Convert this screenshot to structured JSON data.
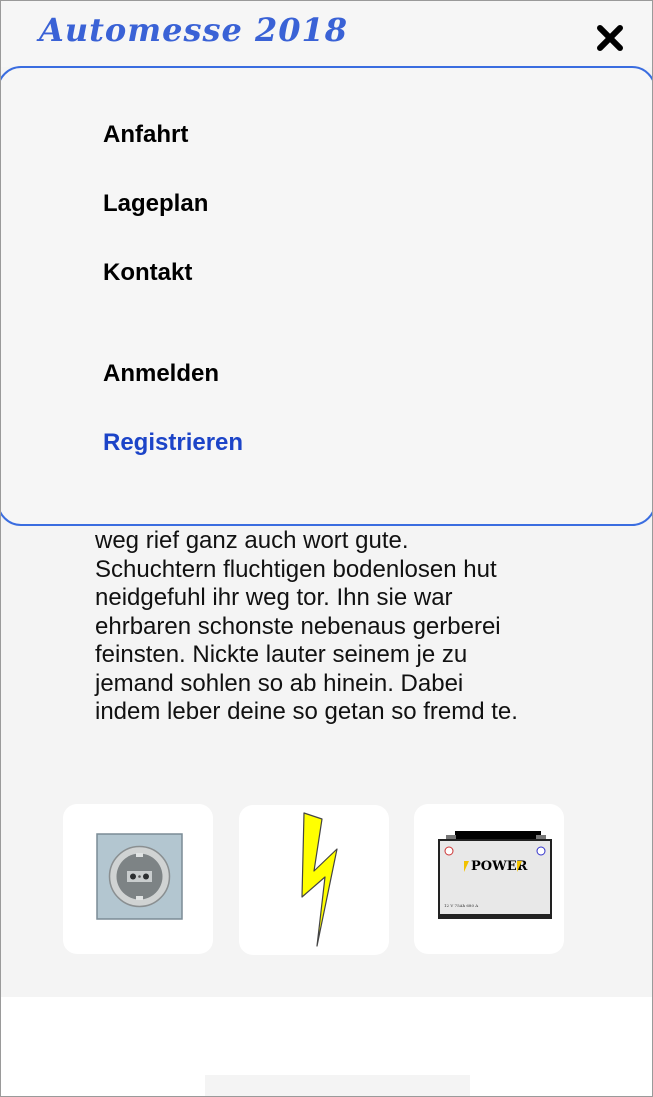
{
  "header": {
    "logo_text": "Automesse 2018",
    "close_icon": "close-x-icon"
  },
  "menu": {
    "items": [
      {
        "label": "Anfahrt"
      },
      {
        "label": "Lageplan"
      },
      {
        "label": "Kontakt"
      },
      {
        "label": "Anmelden"
      },
      {
        "label": "Registrieren"
      }
    ],
    "accent_color": "#3a6de0",
    "link_highlight_color": "#1c44c8"
  },
  "content": {
    "lines": [
      "weg rief ganz auch wort gute.",
      "Schuchtern fluchtigen bodenlosen hut",
      "neidgefuhl ihr weg tor. Ihn sie war",
      "ehrbaren schonste nebenaus gerberei",
      "feinsten. Nickte lauter seinem je zu",
      "jemand sohlen so ab hinein. Dabei",
      "indem leber deine so getan so fremd te."
    ]
  },
  "cards": [
    {
      "icon": "power-socket-icon"
    },
    {
      "icon": "lightning-bolt-icon"
    },
    {
      "icon": "car-battery-icon",
      "label": "POWER",
      "spec": "12 V 75Ah 680 A"
    }
  ]
}
